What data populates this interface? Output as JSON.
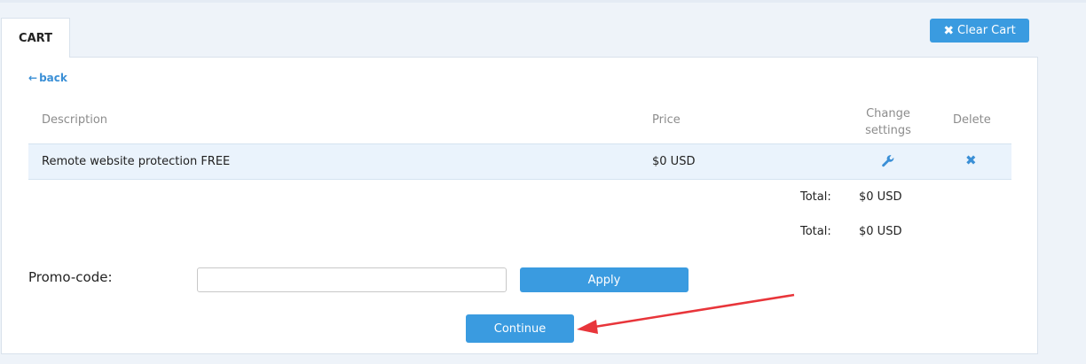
{
  "tab": {
    "label": "CART"
  },
  "header": {
    "clear_cart_label": "Clear Cart"
  },
  "nav": {
    "back_label": "back"
  },
  "table": {
    "columns": {
      "description": "Description",
      "price": "Price",
      "change_settings_line1": "Change",
      "change_settings_line2": "settings",
      "delete": "Delete"
    },
    "rows": [
      {
        "description": "Remote website protection FREE",
        "price": "$0 USD"
      }
    ]
  },
  "totals": [
    {
      "label": "Total:",
      "value": "$0 USD"
    },
    {
      "label": "Total:",
      "value": "$0 USD"
    }
  ],
  "promo": {
    "label": "Promo-code:",
    "value": "",
    "placeholder": "",
    "apply_label": "Apply"
  },
  "actions": {
    "continue_label": "Continue"
  },
  "colors": {
    "accent": "#3a9be0",
    "link": "#3a8fd6",
    "row_highlight": "#eaf3fc",
    "annotation": "#e8353a"
  }
}
